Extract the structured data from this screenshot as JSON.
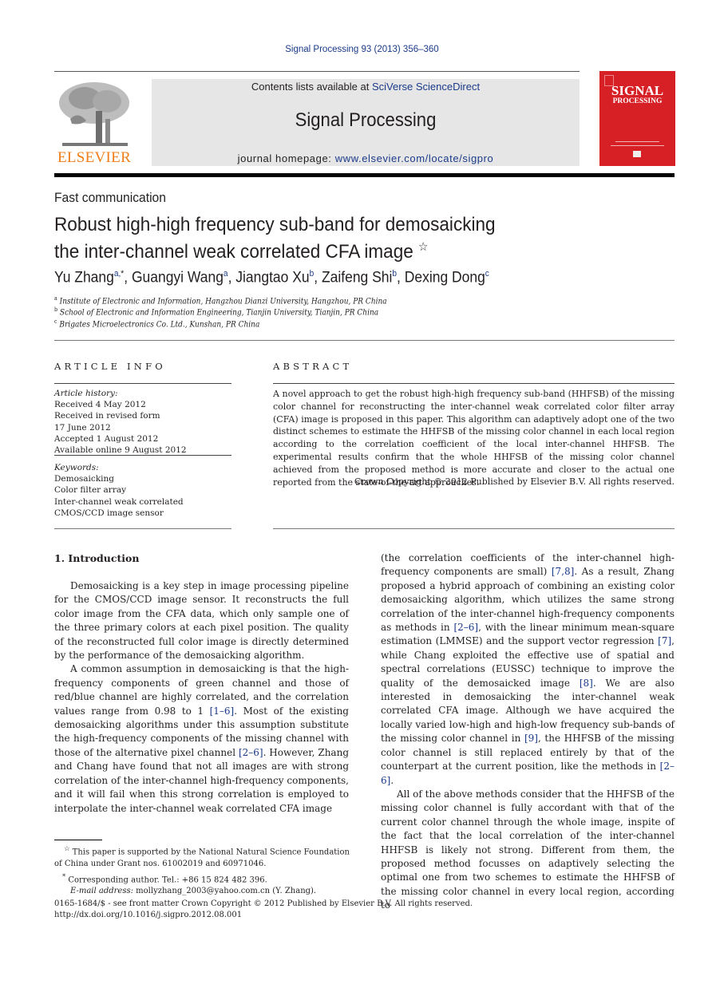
{
  "header": {
    "journal_ref": "Signal Processing 93 (2013) 356–360",
    "contents_prefix": "Contents lists available at ",
    "contents_link": "SciVerse ScienceDirect",
    "journal_name": "Signal Processing",
    "homepage_prefix": "journal homepage: ",
    "homepage_link": "www.elsevier.com/locate/sigpro",
    "publisher_logo_text": "ELSEVIER",
    "cover_title_line1": "SIGNAL",
    "cover_title_line2": "PROCESSING",
    "colors": {
      "link": "#1a3a8a",
      "elsevier_orange": "#f07d17",
      "cover_red": "#d71f26",
      "banner_gray": "#e6e6e6"
    }
  },
  "article": {
    "type": "Fast communication",
    "title_line1": "Robust high-high frequency sub-band for demosaicking",
    "title_line2": "the inter-channel weak correlated CFA image",
    "title_note_mark": "☆",
    "authors": [
      {
        "name": "Yu Zhang",
        "sup": "a,",
        "star": "*"
      },
      {
        "name": "Guangyi Wang",
        "sup": "a"
      },
      {
        "name": "Jiangtao Xu",
        "sup": "b"
      },
      {
        "name": "Zaifeng Shi",
        "sup": "b"
      },
      {
        "name": "Dexing Dong",
        "sup": "c"
      }
    ],
    "affiliations": [
      {
        "mark": "a",
        "text": "Institute of Electronic and Information, Hangzhou Dianzi University, Hangzhou, PR China"
      },
      {
        "mark": "b",
        "text": "School of Electronic and Information Engineering, Tianjin University, Tianjin, PR China"
      },
      {
        "mark": "c",
        "text": "Brigates Microelectronics Co. Ltd., Kunshan, PR China"
      }
    ]
  },
  "article_info": {
    "heading": "ARTICLE INFO",
    "history_label": "Article history:",
    "history": [
      "Received 4 May 2012",
      "Received in revised form",
      "17 June 2012",
      "Accepted 1 August 2012",
      "Available online 9 August 2012"
    ],
    "keywords_label": "Keywords:",
    "keywords": [
      "Demosaicking",
      "Color filter array",
      "Inter-channel weak correlated",
      "CMOS/CCD image sensor"
    ]
  },
  "abstract": {
    "heading": "ABSTRACT",
    "text": "A novel approach to get the robust high-high frequency sub-band (HHFSB) of the missing color channel for reconstructing the inter-channel weak correlated color filter array (CFA) image is proposed in this paper. This algorithm can adaptively adopt one of the two distinct schemes to estimate the HHFSB of the missing color channel in each local region according to the correlation coefficient of the local inter-channel HHFSB. The experimental results confirm that the whole HHFSB of the missing color channel achieved from the proposed method is more accurate and closer to the actual one reported from the state-of-the-art approaches.",
    "copyright": "Crown Copyright © 2012 Published by Elsevier B.V. All rights reserved."
  },
  "intro": {
    "heading": "1.  Introduction",
    "left": {
      "p1": "Demosaicking is a key step in image processing pipeline for the CMOS/CCD image sensor. It reconstructs the full color image from the CFA data, which only sample one of the three primary colors at each pixel position. The quality of the reconstructed full color image is directly determined by the performance of the demosaicking algorithm.",
      "p2a": "A common assumption in demosaicking is that the high-frequency components of green channel and those of red/blue channel are highly correlated, and the correlation values range from 0.98 to 1 ",
      "cite1": "[1–6]",
      "p2b": ". Most of the existing demosaicking algorithms under this assumption substitute the high-frequency components of the missing channel with those of the alternative pixel channel ",
      "cite2": "[2–6]",
      "p2c": ". However, Zhang and Chang have found that not all images are with strong correlation of the inter-channel high-frequency components, and it will fail when this strong correlation is employed to interpolate the inter-channel weak correlated CFA image"
    },
    "right": {
      "p1a": "(the correlation coefficients of the inter-channel high-frequency components are small) ",
      "cite1": "[7,8]",
      "p1b": ". As a result, Zhang proposed a hybrid approach of combining an existing color demosaicking algorithm, which utilizes the same strong correlation of the inter-channel high-frequency components as methods in ",
      "cite2": "[2–6]",
      "p1c": ", with the linear minimum mean-square estimation (LMMSE) and the support vector regression ",
      "cite3": "[7]",
      "p1d": ", while Chang exploited the effective use of spatial and spectral correlations (EUSSC) technique to improve the quality of the demosaicked image ",
      "cite4": "[8]",
      "p1e": ". We are also interested in demosaicking the inter-channel weak correlated CFA image. Although we have acquired the locally varied low-high and high-low frequency sub-bands of the missing color channel in ",
      "cite5": "[9]",
      "p1f": ", the HHFSB of the missing color channel is still replaced entirely by that of the counterpart at the current position, like the methods in ",
      "cite6": "[2–6]",
      "p1g": ".",
      "p2": "All of the above methods consider that the HHFSB of the missing color channel is fully accordant with that of the current color channel through the whole image, inspite of the fact that the local correlation of the inter-channel HHFSB is likely not strong. Different from them, the proposed method focusses on adaptively selecting the optimal one from two schemes to estimate the HHFSB of the missing color channel in every local region, according to"
    }
  },
  "footnotes": {
    "fn1_mark": "☆",
    "fn1_line1": " This paper is supported by the National Natural Science Foundation",
    "fn1_line2": "of China under Grant nos. 61002019 and 60971046.",
    "fn2_mark": "*",
    "fn2": " Corresponding author. Tel.: +86 15 824 482 396.",
    "email_label": "E-mail address:",
    "email": " mollyzhang_2003@yahoo.com.cn (Y. Zhang)."
  },
  "bottom": {
    "issn_line": "0165-1684/$ - see front matter Crown Copyright © 2012 Published by Elsevier B.V. All rights reserved.",
    "doi_link": "http://dx.doi.org/10.1016/j.sigpro.2012.08.001"
  }
}
